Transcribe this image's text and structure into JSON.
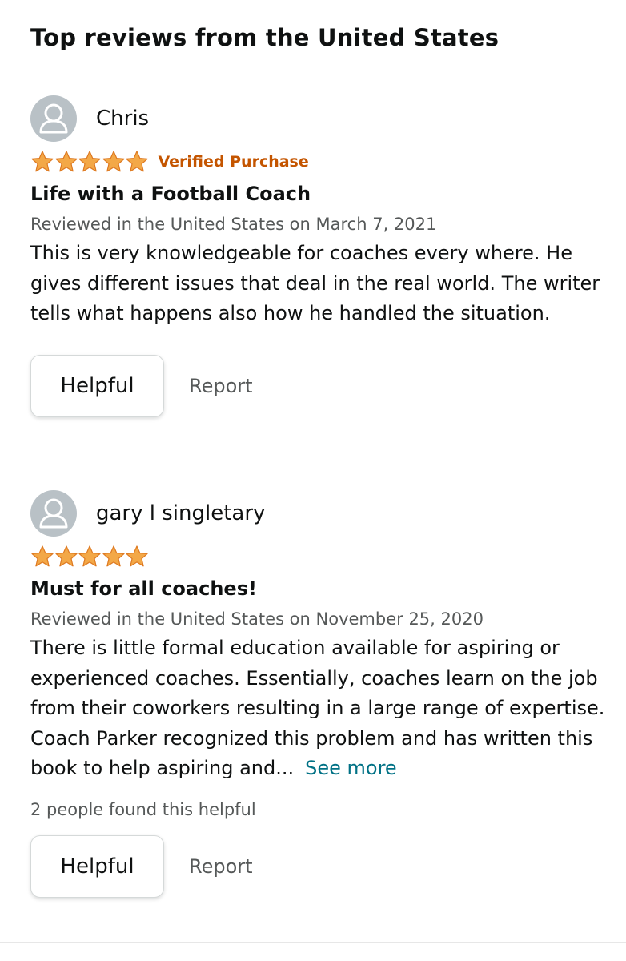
{
  "section": {
    "title": "Top reviews from the United States"
  },
  "reviews": [
    {
      "reviewer": "Chris",
      "rating": 5,
      "verified": "Verified Purchase",
      "title": "Life with a Football Coach",
      "date": "Reviewed in the United States on March 7, 2021",
      "body": "This is very knowledgeable for coaches every where. He gives different issues that deal in the real world. The writer tells what happens also how he handled the situation.",
      "helpful_label": "Helpful",
      "report_label": "Report"
    },
    {
      "reviewer": "gary l singletary",
      "rating": 5,
      "title": "Must for all coaches!",
      "date": "Reviewed in the United States on November 25, 2020",
      "body": "There is little formal education available for aspiring or experienced coaches. Essentially, coaches learn on the job from their coworkers resulting in a large range of expertise. Coach Parker recognized this problem and has written this book to help aspiring and...",
      "see_more": "See more",
      "helpful_count": "2 people found this helpful",
      "helpful_label": "Helpful",
      "report_label": "Report"
    }
  ],
  "colors": {
    "star": "#f3a847",
    "verified": "#c45500",
    "link": "#007185",
    "muted": "#565959",
    "avatar": "#b9c1c6"
  },
  "icons": {
    "avatar": "user-silhouette-icon",
    "star": "star-filled-icon"
  }
}
